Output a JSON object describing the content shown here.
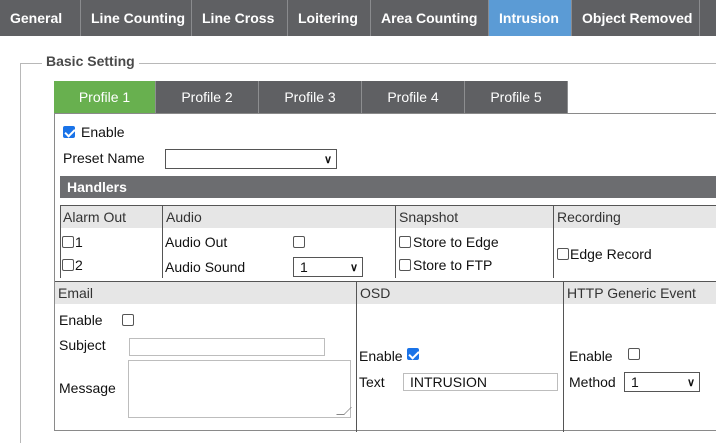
{
  "top_tabs": [
    "General",
    "Line Counting",
    "Line Cross",
    "Loitering",
    "Area Counting",
    "Intrusion",
    "Object Removed"
  ],
  "active_top_tab": "Intrusion",
  "section_title": "Basic Setting",
  "profile_tabs": [
    "Profile 1",
    "Profile 2",
    "Profile 3",
    "Profile 4",
    "Profile 5"
  ],
  "active_profile": "Profile 1",
  "enable": {
    "label": "Enable",
    "checked": true
  },
  "preset": {
    "label": "Preset Name",
    "value": ""
  },
  "handlers": {
    "title": "Handlers",
    "alarm_out": {
      "header": "Alarm Out",
      "items": [
        "1",
        "2"
      ]
    },
    "audio": {
      "header": "Audio",
      "audio_out_label": "Audio Out",
      "audio_sound_label": "Audio Sound",
      "audio_sound_value": "1"
    },
    "snapshot": {
      "header": "Snapshot",
      "items": [
        "Store to Edge",
        "Store to FTP"
      ]
    },
    "recording": {
      "header": "Recording",
      "item": "Edge Record"
    }
  },
  "email": {
    "header": "Email",
    "enable_label": "Enable",
    "subject_label": "Subject",
    "message_label": "Message",
    "subject_value": "",
    "message_value": ""
  },
  "osd": {
    "header": "OSD",
    "enable_label": "Enable",
    "enable_checked": true,
    "text_label": "Text",
    "text_value": "INTRUSION"
  },
  "http": {
    "header": "HTTP Generic Event",
    "enable_label": "Enable",
    "method_label": "Method",
    "method_value": "1"
  },
  "colors": {
    "tab_bg": "#5f6063",
    "active_tab": "#5b9bd5",
    "active_profile": "#68b04f",
    "handlers_bar": "#6c6d70",
    "checkbox_on": "#1a73e8"
  }
}
